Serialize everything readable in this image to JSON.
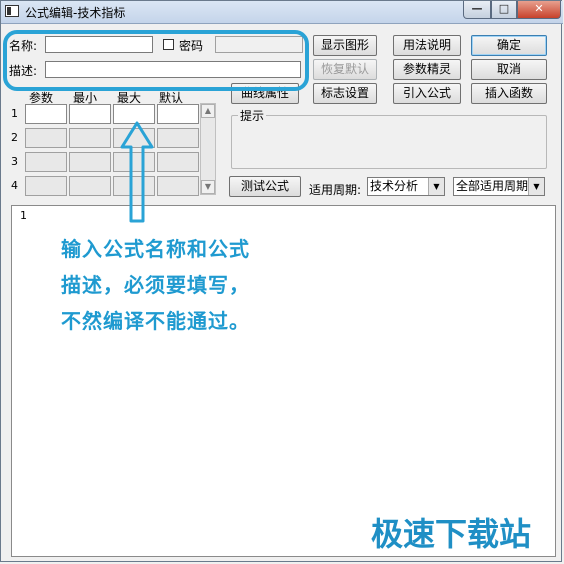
{
  "window": {
    "title": "公式编辑-技术指标",
    "controls": {
      "minimize": "—",
      "maximize": "□",
      "close": "✕"
    }
  },
  "form": {
    "name_label": "名称:",
    "name_value": "",
    "password_label": "密码",
    "password_checked": false,
    "desc_label": "描述:",
    "desc_value": ""
  },
  "buttons": {
    "show_graph": "显示图形",
    "usage": "用法说明",
    "ok": "确定",
    "restore_default": "恢复默认",
    "param_wizard": "参数精灵",
    "cancel": "取消",
    "curve_props": "曲线属性",
    "marker_settings": "标志设置",
    "import_formula": "引入公式",
    "insert_function": "插入函数",
    "test_formula": "测试公式"
  },
  "params_table": {
    "headers": [
      "参数",
      "最小",
      "最大",
      "默认"
    ],
    "rows": [
      "1",
      "2",
      "3",
      "4"
    ]
  },
  "hint": {
    "label": "提示",
    "text": ""
  },
  "period": {
    "label": "适用周期:",
    "type_value": "技术分析",
    "cycle_value": "全部适用周期"
  },
  "editor": {
    "line_number": "1",
    "content": ""
  },
  "annotation": {
    "lines": [
      "输入公式名称和公式",
      "描述，必须要填写，",
      "不然编译不能通过。"
    ]
  },
  "watermark": "极速下载站",
  "colors": {
    "annotation": "#1f9ad0",
    "highlight_border": "#2aa3d6",
    "watermark": "#1f8fc5"
  }
}
